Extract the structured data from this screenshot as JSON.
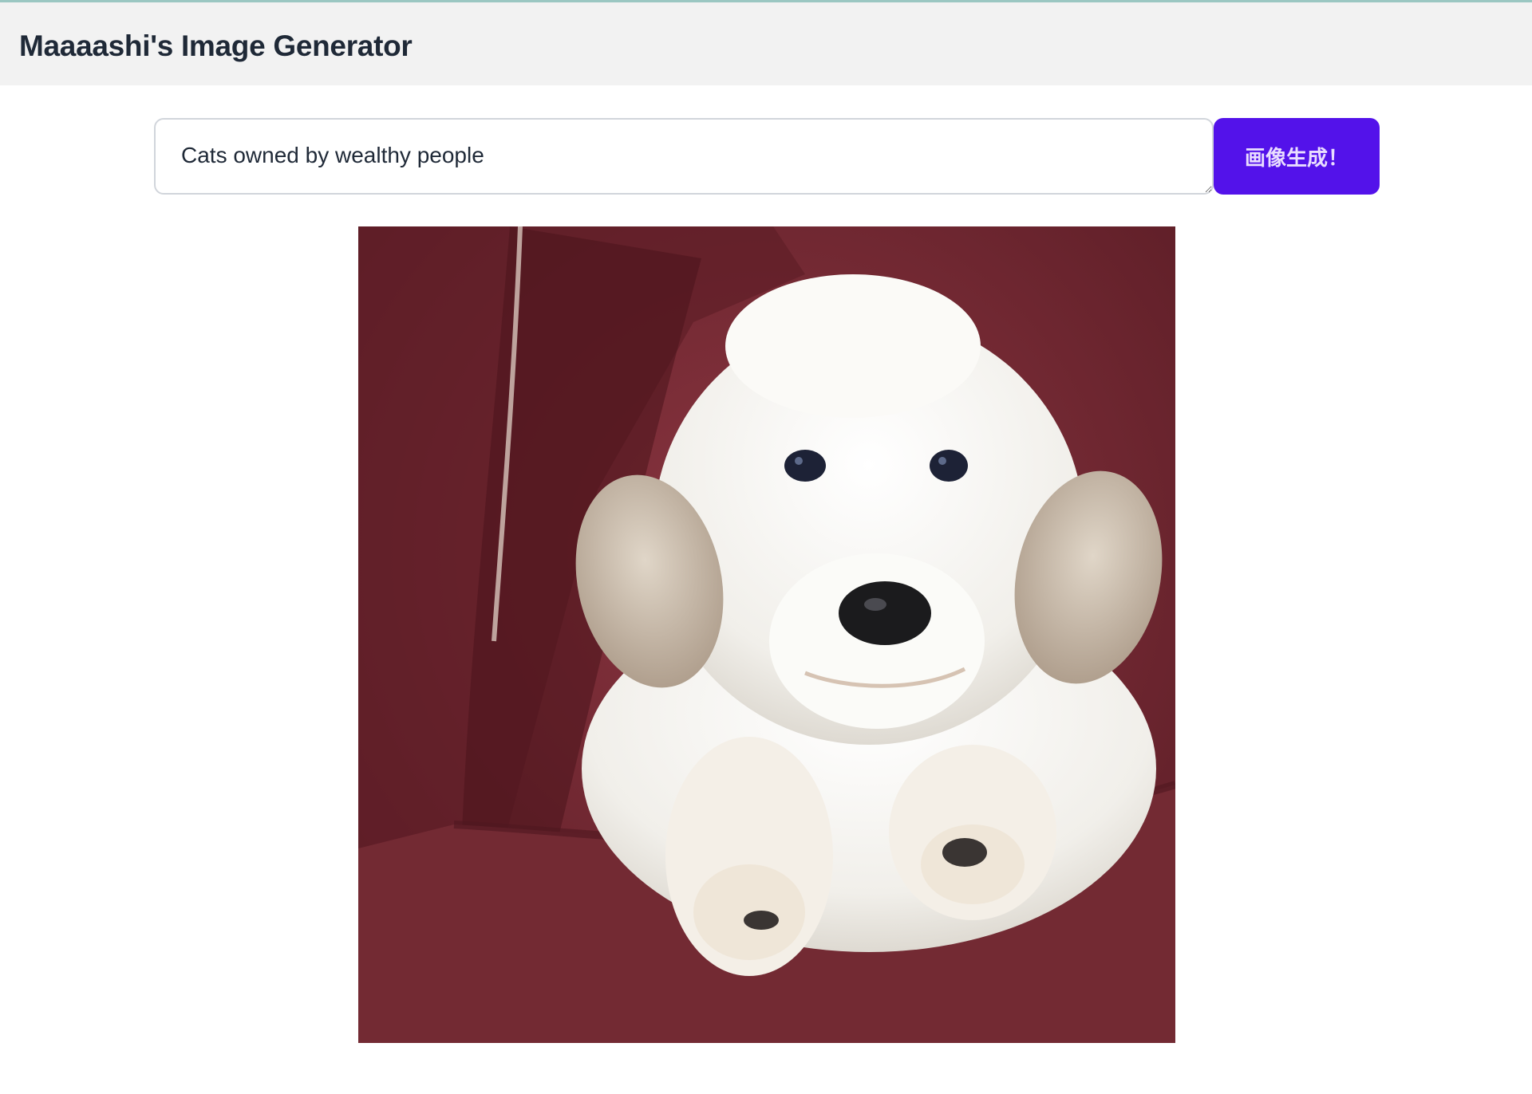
{
  "app": {
    "title": "Maaaashi's Image Generator"
  },
  "prompt": {
    "value": "Cats owned by wealthy people",
    "placeholder": ""
  },
  "generate": {
    "label": "画像生成！"
  },
  "result": {
    "alt": "generated image",
    "subject": "white fluffy puppy on red couch"
  },
  "colors": {
    "header_bg": "#f2f2f2",
    "button_bg": "#5312ea",
    "button_text": "#e9ddff",
    "couch": "#7a2a34"
  }
}
